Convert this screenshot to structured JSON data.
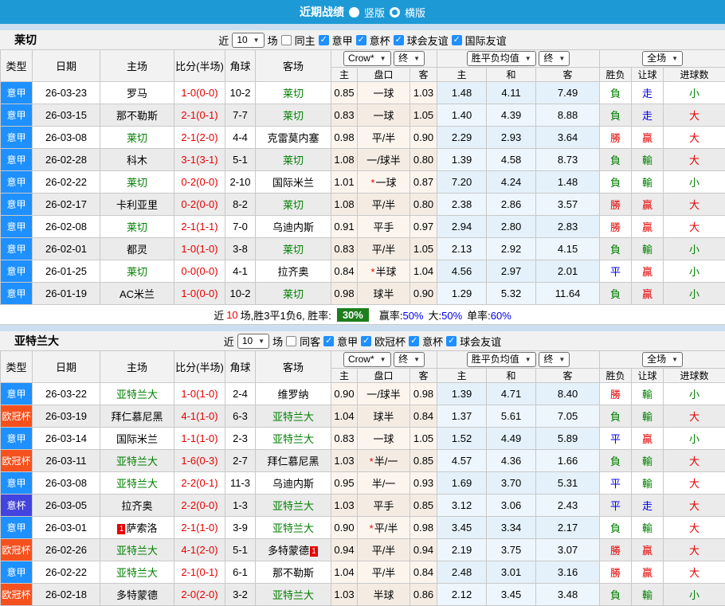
{
  "topbar": {
    "title": "近期战绩",
    "vertical_label": "竖版",
    "horizontal_label": "横版"
  },
  "columns": {
    "type": "类型",
    "date": "日期",
    "home": "主场",
    "score": "比分(半场)",
    "corner": "角球",
    "away": "客场",
    "home_short": "主",
    "handicap": "盘口",
    "away_short": "客",
    "avg_home": "主",
    "avg_draw": "和",
    "avg_away": "客",
    "wdl": "胜负",
    "handicap_result": "让球",
    "goals": "进球数"
  },
  "controls": {
    "bookmaker": "Crow*",
    "final": "终",
    "avg": "胜平负均值",
    "final2": "终",
    "scope": "全场"
  },
  "colors": {
    "league": {
      "意甲": "#1E90FF",
      "欧冠杯": "#F4511E",
      "意杯": "#4343DF"
    },
    "result": {
      "r": "#E60000",
      "g": "#008000",
      "b": "#0000E6"
    },
    "topbar": "#1D9AD6",
    "win_rate_badge": "#1E7E1E"
  },
  "sections": [
    {
      "team": "莱切",
      "filters": {
        "near": "近",
        "count": "10",
        "unit": "场",
        "same_label": "同主",
        "leagues": [
          "意甲",
          "意杯",
          "球会友谊",
          "国际友谊"
        ]
      },
      "rows": [
        {
          "type": "意甲",
          "date": "26-03-23",
          "home": "罗马",
          "home_focus": false,
          "home_card": "",
          "score": "1-0(0-0)",
          "corner": "10-2",
          "away": "莱切",
          "away_focus": true,
          "away_card": "",
          "h": "0.85",
          "line": "一球",
          "star": false,
          "a": "1.03",
          "avg_h": "1.48",
          "avg_d": "4.11",
          "avg_a": "7.49",
          "wdl": "負",
          "wdl_c": "g",
          "hc": "走",
          "hc_c": "b",
          "ou": "小",
          "ou_c": "g"
        },
        {
          "type": "意甲",
          "date": "26-03-15",
          "home": "那不勒斯",
          "home_focus": false,
          "home_card": "",
          "score": "2-1(0-1)",
          "corner": "7-7",
          "away": "莱切",
          "away_focus": true,
          "away_card": "",
          "h": "0.83",
          "line": "一球",
          "star": false,
          "a": "1.05",
          "avg_h": "1.40",
          "avg_d": "4.39",
          "avg_a": "8.88",
          "wdl": "負",
          "wdl_c": "g",
          "hc": "走",
          "hc_c": "b",
          "ou": "大",
          "ou_c": "r"
        },
        {
          "type": "意甲",
          "date": "26-03-08",
          "home": "莱切",
          "home_focus": true,
          "home_card": "",
          "score": "2-1(2-0)",
          "corner": "4-4",
          "away": "克雷莫内塞",
          "away_focus": false,
          "away_card": "",
          "h": "0.98",
          "line": "平/半",
          "star": false,
          "a": "0.90",
          "avg_h": "2.29",
          "avg_d": "2.93",
          "avg_a": "3.64",
          "wdl": "勝",
          "wdl_c": "r",
          "hc": "贏",
          "hc_c": "r",
          "ou": "大",
          "ou_c": "r"
        },
        {
          "type": "意甲",
          "date": "26-02-28",
          "home": "科木",
          "home_focus": false,
          "home_card": "",
          "score": "3-1(3-1)",
          "corner": "5-1",
          "away": "莱切",
          "away_focus": true,
          "away_card": "",
          "h": "1.08",
          "line": "一/球半",
          "star": false,
          "a": "0.80",
          "avg_h": "1.39",
          "avg_d": "4.58",
          "avg_a": "8.73",
          "wdl": "負",
          "wdl_c": "g",
          "hc": "輸",
          "hc_c": "g",
          "ou": "大",
          "ou_c": "r"
        },
        {
          "type": "意甲",
          "date": "26-02-22",
          "home": "莱切",
          "home_focus": true,
          "home_card": "",
          "score": "0-2(0-0)",
          "corner": "2-10",
          "away": "国际米兰",
          "away_focus": false,
          "away_card": "",
          "h": "1.01",
          "line": "一球",
          "star": true,
          "a": "0.87",
          "avg_h": "7.20",
          "avg_d": "4.24",
          "avg_a": "1.48",
          "wdl": "負",
          "wdl_c": "g",
          "hc": "輸",
          "hc_c": "g",
          "ou": "小",
          "ou_c": "g"
        },
        {
          "type": "意甲",
          "date": "26-02-17",
          "home": "卡利亚里",
          "home_focus": false,
          "home_card": "",
          "score": "0-2(0-0)",
          "corner": "8-2",
          "away": "莱切",
          "away_focus": true,
          "away_card": "",
          "h": "1.08",
          "line": "平/半",
          "star": false,
          "a": "0.80",
          "avg_h": "2.38",
          "avg_d": "2.86",
          "avg_a": "3.57",
          "wdl": "勝",
          "wdl_c": "r",
          "hc": "贏",
          "hc_c": "r",
          "ou": "大",
          "ou_c": "r"
        },
        {
          "type": "意甲",
          "date": "26-02-08",
          "home": "莱切",
          "home_focus": true,
          "home_card": "",
          "score": "2-1(1-1)",
          "corner": "7-0",
          "away": "乌迪内斯",
          "away_focus": false,
          "away_card": "",
          "h": "0.91",
          "line": "平手",
          "star": false,
          "a": "0.97",
          "avg_h": "2.94",
          "avg_d": "2.80",
          "avg_a": "2.83",
          "wdl": "勝",
          "wdl_c": "r",
          "hc": "贏",
          "hc_c": "r",
          "ou": "大",
          "ou_c": "r"
        },
        {
          "type": "意甲",
          "date": "26-02-01",
          "home": "都灵",
          "home_focus": false,
          "home_card": "",
          "score": "1-0(1-0)",
          "corner": "3-8",
          "away": "莱切",
          "away_focus": true,
          "away_card": "",
          "h": "0.83",
          "line": "平/半",
          "star": false,
          "a": "1.05",
          "avg_h": "2.13",
          "avg_d": "2.92",
          "avg_a": "4.15",
          "wdl": "負",
          "wdl_c": "g",
          "hc": "輸",
          "hc_c": "g",
          "ou": "小",
          "ou_c": "g"
        },
        {
          "type": "意甲",
          "date": "26-01-25",
          "home": "莱切",
          "home_focus": true,
          "home_card": "",
          "score": "0-0(0-0)",
          "corner": "4-1",
          "away": "拉齐奥",
          "away_focus": false,
          "away_card": "",
          "h": "0.84",
          "line": "半球",
          "star": true,
          "a": "1.04",
          "avg_h": "4.56",
          "avg_d": "2.97",
          "avg_a": "2.01",
          "wdl": "平",
          "wdl_c": "b",
          "hc": "贏",
          "hc_c": "r",
          "ou": "小",
          "ou_c": "g"
        },
        {
          "type": "意甲",
          "date": "26-01-19",
          "home": "AC米兰",
          "home_focus": false,
          "home_card": "",
          "score": "1-0(0-0)",
          "corner": "10-2",
          "away": "莱切",
          "away_focus": true,
          "away_card": "",
          "h": "0.98",
          "line": "球半",
          "star": false,
          "a": "0.90",
          "avg_h": "1.29",
          "avg_d": "5.32",
          "avg_a": "11.64",
          "wdl": "負",
          "wdl_c": "g",
          "hc": "贏",
          "hc_c": "r",
          "ou": "小",
          "ou_c": "g"
        }
      ],
      "summary": {
        "prefix": "近",
        "count": "10",
        "middle": "场,胜3平1负6, 胜率:",
        "win_rate": "30%",
        "stats": [
          {
            "label": "赢率:",
            "value": "50%"
          },
          {
            "label": "大:",
            "value": "50%"
          },
          {
            "label": "单率:",
            "value": "60%"
          }
        ]
      }
    },
    {
      "team": "亚特兰大",
      "filters": {
        "near": "近",
        "count": "10",
        "unit": "场",
        "same_label": "同客",
        "leagues": [
          "意甲",
          "欧冠杯",
          "意杯",
          "球会友谊"
        ]
      },
      "rows": [
        {
          "type": "意甲",
          "date": "26-03-22",
          "home": "亚特兰大",
          "home_focus": true,
          "home_card": "",
          "score": "1-0(1-0)",
          "corner": "2-4",
          "away": "维罗纳",
          "away_focus": false,
          "away_card": "",
          "h": "0.90",
          "line": "一/球半",
          "star": false,
          "a": "0.98",
          "avg_h": "1.39",
          "avg_d": "4.71",
          "avg_a": "8.40",
          "wdl": "勝",
          "wdl_c": "r",
          "hc": "輸",
          "hc_c": "g",
          "ou": "小",
          "ou_c": "g"
        },
        {
          "type": "欧冠杯",
          "date": "26-03-19",
          "home": "拜仁慕尼黑",
          "home_focus": false,
          "home_card": "",
          "score": "4-1(1-0)",
          "corner": "6-3",
          "away": "亚特兰大",
          "away_focus": true,
          "away_card": "",
          "h": "1.04",
          "line": "球半",
          "star": false,
          "a": "0.84",
          "avg_h": "1.37",
          "avg_d": "5.61",
          "avg_a": "7.05",
          "wdl": "負",
          "wdl_c": "g",
          "hc": "輸",
          "hc_c": "g",
          "ou": "大",
          "ou_c": "r"
        },
        {
          "type": "意甲",
          "date": "26-03-14",
          "home": "国际米兰",
          "home_focus": false,
          "home_card": "",
          "score": "1-1(1-0)",
          "corner": "2-3",
          "away": "亚特兰大",
          "away_focus": true,
          "away_card": "",
          "h": "0.83",
          "line": "一球",
          "star": false,
          "a": "1.05",
          "avg_h": "1.52",
          "avg_d": "4.49",
          "avg_a": "5.89",
          "wdl": "平",
          "wdl_c": "b",
          "hc": "贏",
          "hc_c": "r",
          "ou": "小",
          "ou_c": "g"
        },
        {
          "type": "欧冠杯",
          "date": "26-03-11",
          "home": "亚特兰大",
          "home_focus": true,
          "home_card": "",
          "score": "1-6(0-3)",
          "corner": "2-7",
          "away": "拜仁慕尼黑",
          "away_focus": false,
          "away_card": "",
          "h": "1.03",
          "line": "半/一",
          "star": true,
          "a": "0.85",
          "avg_h": "4.57",
          "avg_d": "4.36",
          "avg_a": "1.66",
          "wdl": "負",
          "wdl_c": "g",
          "hc": "輸",
          "hc_c": "g",
          "ou": "大",
          "ou_c": "r"
        },
        {
          "type": "意甲",
          "date": "26-03-08",
          "home": "亚特兰大",
          "home_focus": true,
          "home_card": "",
          "score": "2-2(0-1)",
          "corner": "11-3",
          "away": "乌迪内斯",
          "away_focus": false,
          "away_card": "",
          "h": "0.95",
          "line": "半/一",
          "star": false,
          "a": "0.93",
          "avg_h": "1.69",
          "avg_d": "3.70",
          "avg_a": "5.31",
          "wdl": "平",
          "wdl_c": "b",
          "hc": "輸",
          "hc_c": "g",
          "ou": "大",
          "ou_c": "r"
        },
        {
          "type": "意杯",
          "date": "26-03-05",
          "home": "拉齐奥",
          "home_focus": false,
          "home_card": "",
          "score": "2-2(0-0)",
          "corner": "1-3",
          "away": "亚特兰大",
          "away_focus": true,
          "away_card": "",
          "h": "1.03",
          "line": "平手",
          "star": false,
          "a": "0.85",
          "avg_h": "3.12",
          "avg_d": "3.06",
          "avg_a": "2.43",
          "wdl": "平",
          "wdl_c": "b",
          "hc": "走",
          "hc_c": "b",
          "ou": "大",
          "ou_c": "r"
        },
        {
          "type": "意甲",
          "date": "26-03-01",
          "home": "萨索洛",
          "home_focus": false,
          "home_card": "1",
          "score": "2-1(1-0)",
          "corner": "3-9",
          "away": "亚特兰大",
          "away_focus": true,
          "away_card": "",
          "h": "0.90",
          "line": "平/半",
          "star": true,
          "a": "0.98",
          "avg_h": "3.45",
          "avg_d": "3.34",
          "avg_a": "2.17",
          "wdl": "負",
          "wdl_c": "g",
          "hc": "輸",
          "hc_c": "g",
          "ou": "大",
          "ou_c": "r"
        },
        {
          "type": "欧冠杯",
          "date": "26-02-26",
          "home": "亚特兰大",
          "home_focus": true,
          "home_card": "",
          "score": "4-1(2-0)",
          "corner": "5-1",
          "away": "多特蒙德",
          "away_focus": false,
          "away_card": "1",
          "h": "0.94",
          "line": "平/半",
          "star": false,
          "a": "0.94",
          "avg_h": "2.19",
          "avg_d": "3.75",
          "avg_a": "3.07",
          "wdl": "勝",
          "wdl_c": "r",
          "hc": "贏",
          "hc_c": "r",
          "ou": "大",
          "ou_c": "r"
        },
        {
          "type": "意甲",
          "date": "26-02-22",
          "home": "亚特兰大",
          "home_focus": true,
          "home_card": "",
          "score": "2-1(0-1)",
          "corner": "6-1",
          "away": "那不勒斯",
          "away_focus": false,
          "away_card": "",
          "h": "1.04",
          "line": "平/半",
          "star": false,
          "a": "0.84",
          "avg_h": "2.48",
          "avg_d": "3.01",
          "avg_a": "3.16",
          "wdl": "勝",
          "wdl_c": "r",
          "hc": "贏",
          "hc_c": "r",
          "ou": "大",
          "ou_c": "r"
        },
        {
          "type": "欧冠杯",
          "date": "26-02-18",
          "home": "多特蒙德",
          "home_focus": false,
          "home_card": "",
          "score": "2-0(2-0)",
          "corner": "3-2",
          "away": "亚特兰大",
          "away_focus": true,
          "away_card": "",
          "h": "1.03",
          "line": "半球",
          "star": false,
          "a": "0.86",
          "avg_h": "2.12",
          "avg_d": "3.45",
          "avg_a": "3.48",
          "wdl": "負",
          "wdl_c": "g",
          "hc": "輸",
          "hc_c": "g",
          "ou": "小",
          "ou_c": "g"
        }
      ]
    }
  ]
}
